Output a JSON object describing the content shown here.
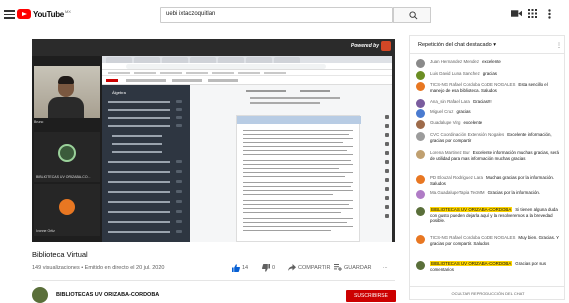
{
  "topbar": {
    "logo_text": "YouTube",
    "logo_region": "MX",
    "search_value": "uebi ixtaczoquitlan"
  },
  "player": {
    "powered_by": "Powered by",
    "cam_name": "Bruno",
    "tile2_label": "BIBLIOTECAS UV ORIZABA-CO...",
    "tile3_label": "Ivonne Ortiz",
    "lms_sidebar_title": "Álgebra"
  },
  "video": {
    "title": "Biblioteca Virtual",
    "meta": "149 visualizaciones • Emitido en directo el 20 jul. 2020",
    "likes": "14",
    "dislikes": "0",
    "share_label": "COMPARTIR",
    "save_label": "GUARDAR",
    "more_label": "..."
  },
  "channel": {
    "name": "BIBLIOTECAS UV ORIZABA-CORDOBA",
    "subscribe_label": "SUSCRIBIRSE"
  },
  "chat": {
    "header": "Repetición del chat destacado",
    "footer": "OCULTAR REPRODUCCIÓN DEL CHAT",
    "messages": [
      {
        "author": "Juan Hernandez Mendez",
        "text": "excelente",
        "color": "#8a8a8a",
        "highlight": false
      },
      {
        "author": "Luis David Luna Sanchez",
        "text": "gracias",
        "color": "#6b8e23",
        "highlight": false
      },
      {
        "author": "TICS-NG Rafael Cordoba CoDE NOGALES",
        "text": "Esta sencillo el manejo de esa biblioteca. Saludos",
        "color": "#e87722",
        "highlight": false
      },
      {
        "author": "Ana_sin Rafael Lara",
        "text": "Gracias!!!",
        "color": "#7a5c9e",
        "highlight": false
      },
      {
        "author": "Miguel Cruz",
        "text": "gracias",
        "color": "#4a7bd0",
        "highlight": false
      },
      {
        "author": "Guadalupe Virg",
        "text": "excelente",
        "color": "#9e6b4a",
        "highlight": false
      },
      {
        "author": "CVC Coordinación Extensión Nogales",
        "text": "Excelente información, gracias por compartir",
        "color": "#9c9c9c",
        "highlight": false
      },
      {
        "author": "Lorena Martinez Bur",
        "text": "Excelente información muchas gracias, será de utilidad para mas información muchas gracias",
        "color": "#c0a070",
        "highlight": false
      },
      {
        "author": "PD Elouzal Rodriguez Lara",
        "text": "Muchas gracias por la información. Saludos",
        "color": "#e87722",
        "highlight": false
      },
      {
        "author": "Ma.GuadalupeTapia TecMM",
        "text": "Gracias por la información.",
        "color": "#b07cc6",
        "highlight": false
      },
      {
        "author": "BIBLIOTECAS UV ORIZABA-CORDOBA",
        "text": "Si tienen alguna duda con gusto pueden dejarla aquí y la resolveremos a la brevedad posible.",
        "color": "#5a6f3a",
        "highlight": true
      },
      {
        "author": "TICS-NG Rafael Cordoba CoDE NOGALES",
        "text": "Muy bien. Gracias. Y gracias por compartir. Saludos",
        "color": "#e87722",
        "highlight": false
      },
      {
        "author": "BIBLIOTECAS UV ORIZABA-CORDOBA",
        "text": "Gracias por sus comentarios",
        "color": "#5a6f3a",
        "highlight": true
      }
    ]
  }
}
